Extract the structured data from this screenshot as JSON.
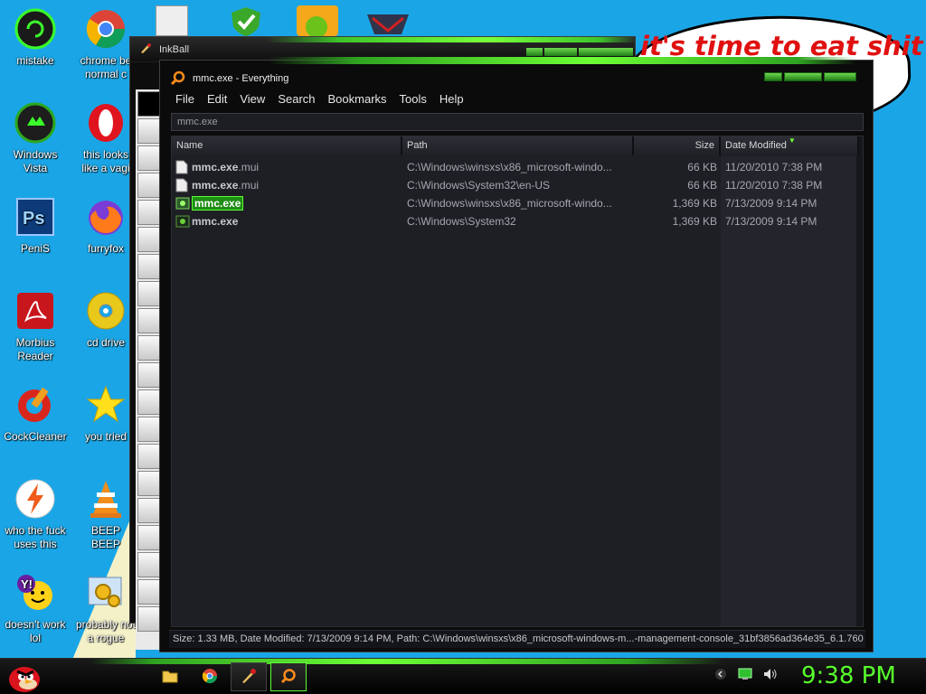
{
  "desktop": {
    "icons": [
      {
        "name": "mistake-icon",
        "label": "mistake"
      },
      {
        "name": "chrome-icon",
        "label": "chrome be\nnormal c"
      },
      {
        "name": "windows-vista-icon",
        "label": "Windows\nVista"
      },
      {
        "name": "opera-icon",
        "label": "this looks\nlike a vagi"
      },
      {
        "name": "photoshop-icon",
        "label": "PeniS"
      },
      {
        "name": "firefox-icon",
        "label": "furryfox"
      },
      {
        "name": "adobe-reader-icon",
        "label": "Morbius\nReader"
      },
      {
        "name": "cd-drive-icon",
        "label": "cd drive"
      },
      {
        "name": "ccleaner-icon",
        "label": "CockCleaner"
      },
      {
        "name": "star-icon",
        "label": "you tried"
      },
      {
        "name": "lightning-icon",
        "label": "who the fuck\nuses this"
      },
      {
        "name": "vlc-icon",
        "label": "BEEP\nBEEP"
      },
      {
        "name": "yahoo-messenger-icon",
        "label": "doesn't work\nlol"
      },
      {
        "name": "gears-icon",
        "label": "probably not\na rogue"
      }
    ],
    "bubble_text": "it's time to eat shit"
  },
  "inkball": {
    "title": "InkBall"
  },
  "everything": {
    "title": "mmc.exe - Everything",
    "menu": [
      "File",
      "Edit",
      "View",
      "Search",
      "Bookmarks",
      "Tools",
      "Help"
    ],
    "search_value": "mmc.exe",
    "columns": {
      "name": "Name",
      "path": "Path",
      "size": "Size",
      "date": "Date Modified"
    },
    "rows": [
      {
        "base": "mmc.exe",
        "ext": ".mui",
        "path": "C:\\Windows\\winsxs\\x86_microsoft-windo...",
        "size": "66 KB",
        "date": "11/20/2010 7:38 PM",
        "selected": false
      },
      {
        "base": "mmc.exe",
        "ext": ".mui",
        "path": "C:\\Windows\\System32\\en-US",
        "size": "66 KB",
        "date": "11/20/2010 7:38 PM",
        "selected": false
      },
      {
        "base": "mmc.exe",
        "ext": "",
        "path": "C:\\Windows\\winsxs\\x86_microsoft-windo...",
        "size": "1,369 KB",
        "date": "7/13/2009 9:14 PM",
        "selected": true
      },
      {
        "base": "mmc.exe",
        "ext": "",
        "path": "C:\\Windows\\System32",
        "size": "1,369 KB",
        "date": "7/13/2009 9:14 PM",
        "selected": false
      }
    ],
    "status": "Size: 1.33 MB, Date Modified: 7/13/2009 9:14 PM, Path: C:\\Windows\\winsxs\\x86_microsoft-windows-m...-management-console_31bf3856ad364e35_6.1.760"
  },
  "taskbar": {
    "clock": "9:38 PM"
  },
  "colors": {
    "desktop": "#1aa6e6",
    "accent_green": "#6dff35",
    "selection": "#1f8c14",
    "list_bg": "#1e1f25"
  }
}
